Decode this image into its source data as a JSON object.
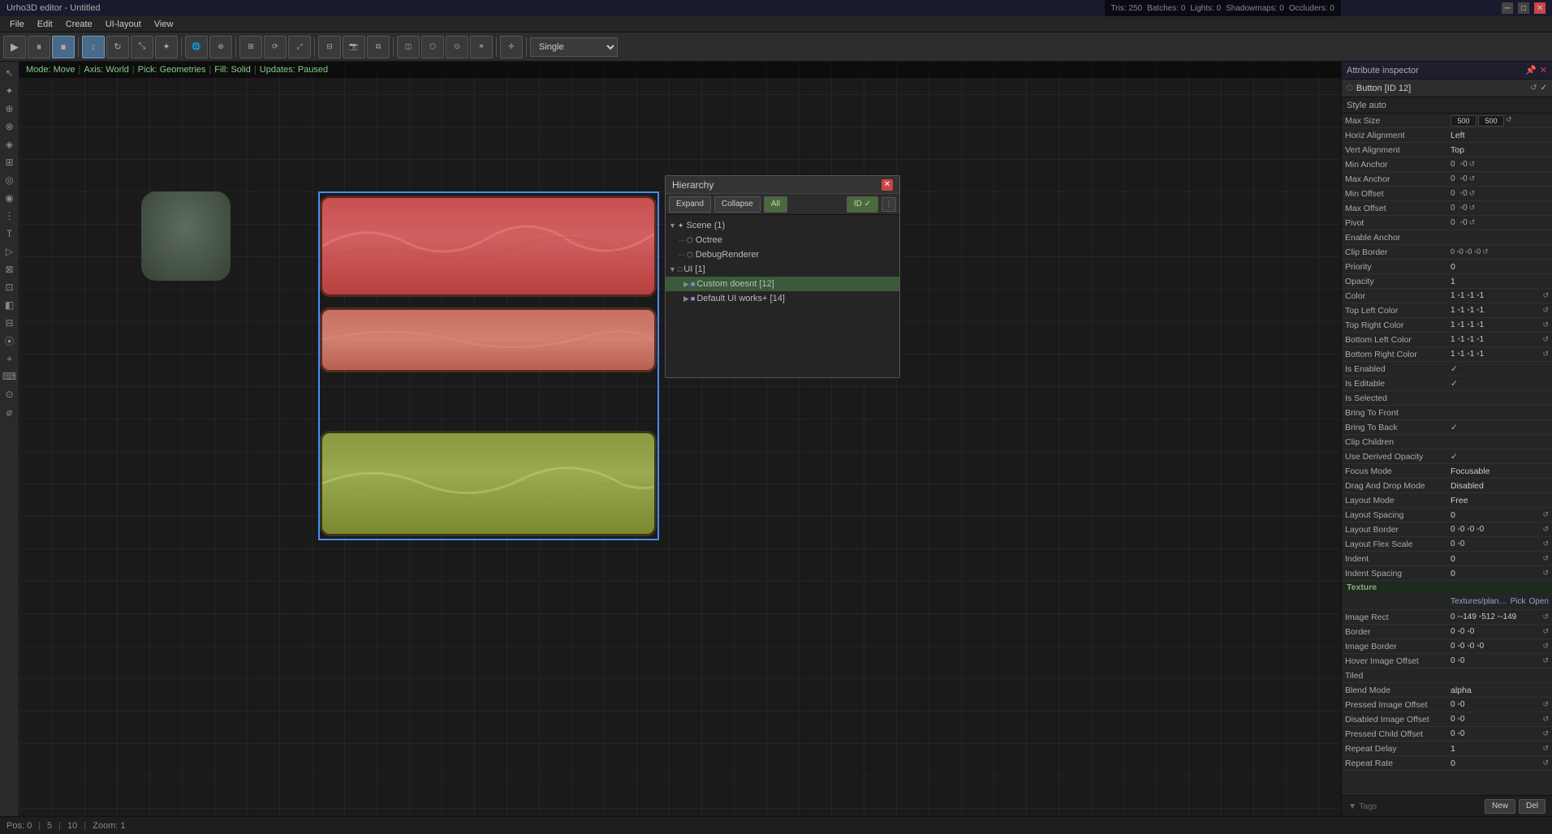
{
  "titlebar": {
    "title": "Urho3D editor - Untitled",
    "controls": [
      "─",
      "□",
      "✕"
    ]
  },
  "menubar": {
    "items": [
      "File",
      "Edit",
      "Create",
      "UI-layout",
      "View"
    ]
  },
  "toolbar": {
    "mode_label": "Single",
    "buttons": [
      {
        "id": "play",
        "icon": "▶",
        "active": false
      },
      {
        "id": "pause",
        "icon": "⏸",
        "active": false
      },
      {
        "id": "stop",
        "icon": "⏹",
        "active": false
      }
    ]
  },
  "modebar": {
    "mode": "Mode: Move",
    "axis": "Axis: World",
    "pick": "Pick: Geometries",
    "fill": "Fill: Solid",
    "updates": "Updates: Paused"
  },
  "stats": {
    "tris": "Tris: 250",
    "batches": "Batches: 0",
    "lights": "Lights: 0",
    "shadowmaps": "Shadowmaps: 0",
    "occluders": "Occluders: 0"
  },
  "hierarchy": {
    "title": "Hierarchy",
    "buttons": {
      "expand": "Expand",
      "collapse": "Collapse",
      "all": "All",
      "id": "ID ✓"
    },
    "scene": "Scene (1)",
    "items": [
      {
        "label": "Octree",
        "type": "node",
        "indent": 1,
        "prefix": "···"
      },
      {
        "label": "DebugRenderer",
        "type": "node",
        "indent": 1,
        "prefix": "···"
      },
      {
        "label": "UI [1]",
        "type": "scene",
        "indent": 0,
        "selected": false,
        "expanded": true
      },
      {
        "label": "Custom doesnt [12]",
        "type": "custom",
        "indent": 2,
        "selected": true
      },
      {
        "label": "Default UI works+ [14]",
        "type": "custom",
        "indent": 2
      }
    ]
  },
  "attr_inspector": {
    "title": "Attribute inspector",
    "node_label": "Button [ID 12]",
    "style_label": "Style auto",
    "rows": [
      {
        "label": "Max Size",
        "value": "500",
        "value2": "500",
        "type": "xy"
      },
      {
        "label": "Horiz Alignment",
        "value": "Left",
        "type": "text"
      },
      {
        "label": "Vert Alignment",
        "value": "Top",
        "type": "text"
      },
      {
        "label": "Min Anchor",
        "value": "0",
        "value2": "0",
        "type": "xy"
      },
      {
        "label": "Max Anchor",
        "value": "0",
        "value2": "0",
        "type": "xy"
      },
      {
        "label": "Min Offset",
        "value": "0",
        "value2": "0",
        "type": "xy"
      },
      {
        "label": "Max Offset",
        "value": "0",
        "value2": "0",
        "type": "xy"
      },
      {
        "label": "Pivot",
        "value": "0",
        "value2": "0",
        "type": "xy"
      },
      {
        "label": "Enable Anchor",
        "value": "",
        "type": "bool_false"
      },
      {
        "label": "Clip Border",
        "value": "0",
        "value2": "0",
        "value3": "0",
        "value4": "0",
        "type": "xyzw"
      },
      {
        "label": "Priority",
        "value": "0",
        "type": "text"
      },
      {
        "label": "Opacity",
        "value": "1",
        "type": "text"
      },
      {
        "label": "Color",
        "value": "1",
        "value2": "1",
        "value3": "1",
        "value4": "1",
        "type": "xyzw"
      },
      {
        "label": "Top Left Color",
        "value": "1",
        "value2": "1",
        "value3": "1",
        "value4": "1",
        "type": "xyzw"
      },
      {
        "label": "Top Right Color",
        "value": "1",
        "value2": "1",
        "value3": "1",
        "value4": "1",
        "type": "xyzw"
      },
      {
        "label": "Bottom Left Color",
        "value": "1",
        "value2": "1",
        "value3": "1",
        "value4": "1",
        "type": "xyzw"
      },
      {
        "label": "Bottom Right Color",
        "value": "1",
        "value2": "1",
        "value3": "1",
        "value4": "1",
        "type": "xyzw"
      },
      {
        "label": "Is Enabled",
        "value": "✓",
        "type": "check"
      },
      {
        "label": "Is Editable",
        "value": "✓",
        "type": "check"
      },
      {
        "label": "Is Selected",
        "value": "",
        "type": "bool_false"
      },
      {
        "label": "Bring To Front",
        "value": "",
        "type": "bool_false"
      },
      {
        "label": "Bring To Back",
        "value": "✓",
        "type": "check"
      },
      {
        "label": "Clip Children",
        "value": "",
        "type": "bool_false"
      },
      {
        "label": "Use Derived Opacity",
        "value": "✓",
        "type": "check"
      },
      {
        "label": "Focus Mode",
        "value": "Focusable",
        "type": "text"
      },
      {
        "label": "Drag And Drop Mode",
        "value": "Disabled",
        "type": "text"
      },
      {
        "label": "Layout Mode",
        "value": "Free",
        "type": "text"
      },
      {
        "label": "Layout Spacing",
        "value": "0",
        "type": "refresh"
      },
      {
        "label": "Layout Border",
        "value": "0",
        "value2": "0",
        "value3": "0",
        "value4": "0",
        "type": "xyzw"
      },
      {
        "label": "Layout Flex Scale",
        "value": "0",
        "value2": "0",
        "type": "xy"
      },
      {
        "label": "Indent",
        "value": "0",
        "type": "refresh"
      },
      {
        "label": "Indent Spacing",
        "value": "0",
        "type": "refresh"
      }
    ],
    "texture_section": "Texture",
    "texture_path": "Textures/planks.png",
    "texture_actions": [
      "Pick",
      "Open"
    ],
    "texture_rows": [
      {
        "label": "Image Rect",
        "value": "0",
        "value2": "-149",
        "value3": "512",
        "value4": "-149",
        "type": "xyzw_dot"
      },
      {
        "label": "Border",
        "value": "0",
        "value2": "0",
        "value3": "0",
        "type": "xyz_dot"
      },
      {
        "label": "Image Border",
        "value": "0",
        "value2": "0",
        "value3": "0",
        "value4": "0",
        "type": "xyzw_dot"
      },
      {
        "label": "Hover Image Offset",
        "value": "0",
        "value2": "0",
        "type": "xy_dot"
      },
      {
        "label": "Tiled",
        "value": "",
        "type": "bool_false"
      },
      {
        "label": "Blend Mode",
        "value": "alpha",
        "type": "text"
      },
      {
        "label": "Pressed Image Offset",
        "value": "0",
        "value2": "0",
        "type": "xy_refresh"
      },
      {
        "label": "Disabled Image Offset",
        "value": "0",
        "value2": "0",
        "type": "xy_refresh"
      },
      {
        "label": "Pressed Child Offset",
        "value": "0",
        "value2": "0",
        "type": "xy_refresh"
      },
      {
        "label": "Repeat Delay",
        "value": "1",
        "type": "refresh"
      },
      {
        "label": "Repeat Rate",
        "value": "0",
        "type": "refresh"
      }
    ],
    "footer": {
      "tags_label": "▼ Tags",
      "new_btn": "New",
      "del_btn": "Del"
    }
  },
  "statusbar": {
    "pos": "Pos: 0",
    "val1": "5",
    "val2": "10",
    "zoom": "Zoom: 1"
  },
  "sidebar_icons": [
    "↖",
    "✦",
    "⊕",
    "⊗",
    "◈",
    "⊞",
    "◎",
    "◉",
    "⋮",
    "T",
    "▷",
    "⊠",
    "⊡",
    "◧",
    "⊟",
    "⦿",
    "⌖",
    "⌨",
    "⊙",
    "⌀"
  ]
}
